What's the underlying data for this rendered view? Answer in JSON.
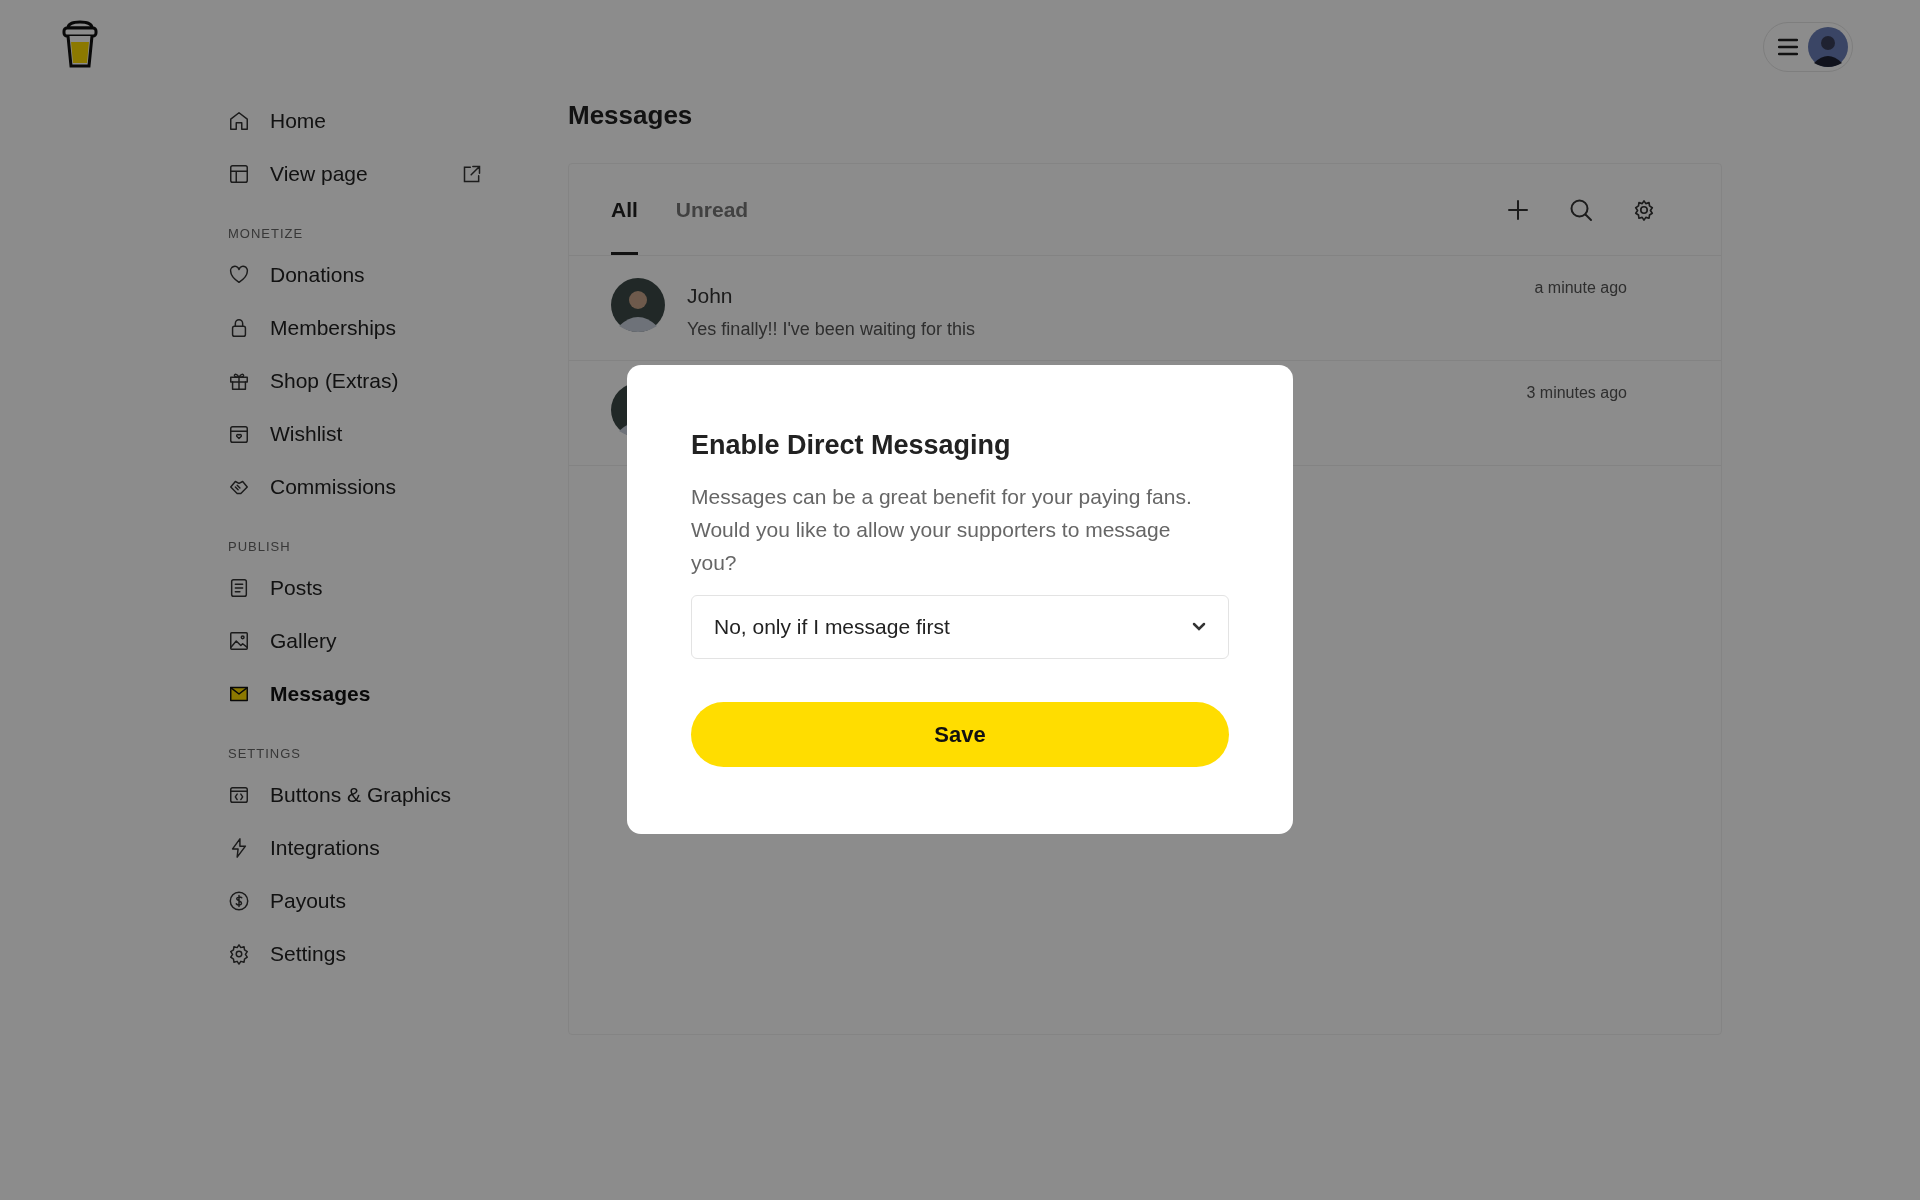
{
  "sidebar": {
    "sections": [
      {
        "items": [
          {
            "label": "Home",
            "selected": false
          },
          {
            "label": "View page",
            "selected": false,
            "external": true
          }
        ]
      },
      {
        "heading": "MONETIZE",
        "items": [
          {
            "label": "Donations",
            "selected": false
          },
          {
            "label": "Memberships",
            "selected": false
          },
          {
            "label": "Shop (Extras)",
            "selected": false
          },
          {
            "label": "Wishlist",
            "selected": false
          },
          {
            "label": "Commissions",
            "selected": false
          }
        ]
      },
      {
        "heading": "PUBLISH",
        "items": [
          {
            "label": "Posts",
            "selected": false
          },
          {
            "label": "Gallery",
            "selected": false
          },
          {
            "label": "Messages",
            "selected": true
          }
        ]
      },
      {
        "heading": "SETTINGS",
        "items": [
          {
            "label": "Buttons & Graphics",
            "selected": false
          },
          {
            "label": "Integrations",
            "selected": false
          },
          {
            "label": "Payouts",
            "selected": false
          },
          {
            "label": "Settings",
            "selected": false
          }
        ]
      }
    ]
  },
  "page_title": "Messages",
  "tabs": [
    {
      "label": "All",
      "selected": true
    },
    {
      "label": "Unread",
      "selected": false
    }
  ],
  "messages": [
    {
      "name": "John",
      "preview": "Yes finally!! I've been waiting for this",
      "time": "a minute ago"
    },
    {
      "time": "3 minutes ago"
    }
  ],
  "modal": {
    "title": "Enable Direct Messaging",
    "text": "Messages can be a great benefit for your paying fans. Would you like to allow your supporters to message you?",
    "select_value": "No, only if I message first",
    "button": "Save"
  }
}
